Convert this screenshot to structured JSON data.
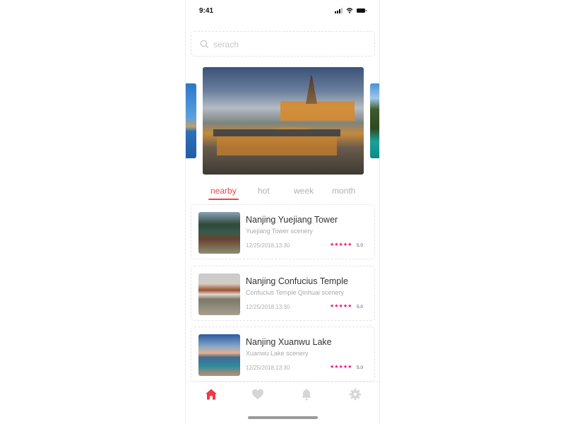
{
  "status_bar": {
    "time": "9:41",
    "icons": [
      "signal-icon",
      "wifi-icon",
      "battery-icon"
    ]
  },
  "search": {
    "placeholder": "serach",
    "icon": "search-icon"
  },
  "carousel": {
    "slides": [
      {
        "name": "lake-slide",
        "position": "left-peek"
      },
      {
        "name": "jiming-temple-slide",
        "position": "center"
      },
      {
        "name": "palm-pool-slide",
        "position": "right-peek"
      }
    ]
  },
  "tabs": [
    {
      "label": "nearby",
      "active": true
    },
    {
      "label": "hot",
      "active": false
    },
    {
      "label": "week",
      "active": false
    },
    {
      "label": "month",
      "active": false
    }
  ],
  "list": [
    {
      "title": "Nanjing Yuejiang Tower",
      "subtitle": "Yuejiang Tower scenery",
      "date": "12/25/2018,13:30",
      "stars": "★★★★★",
      "rating": "5.0"
    },
    {
      "title": "Nanjing Confucius Temple",
      "subtitle": "Confucius Temple Qinhuai scenery",
      "date": "12/25/2018,13:30",
      "stars": "★★★★★",
      "rating": "5.0"
    },
    {
      "title": "Nanjing Xuanwu Lake",
      "subtitle": "Xuanwu Lake scenery",
      "date": "12/25/2018,13:30",
      "stars": "★★★★★",
      "rating": "5.0"
    }
  ],
  "bottom_nav": [
    {
      "name": "home",
      "icon": "home-icon",
      "active": true
    },
    {
      "name": "favorites",
      "icon": "heart-icon",
      "active": false
    },
    {
      "name": "notifications",
      "icon": "bell-icon",
      "active": false
    },
    {
      "name": "settings",
      "icon": "gear-icon",
      "active": false
    }
  ],
  "colors": {
    "accent": "#f0434f",
    "star": "#f0167e",
    "inactive": "#d4d4d4"
  }
}
